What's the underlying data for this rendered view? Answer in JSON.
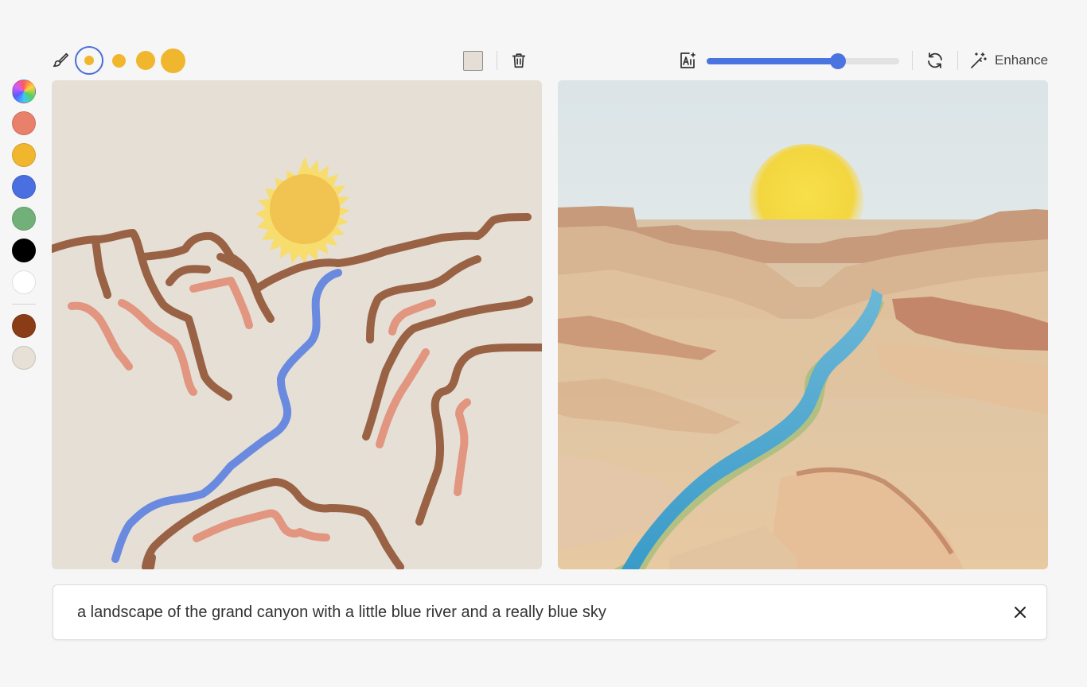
{
  "toolbar": {
    "brush_icon": "brush-icon",
    "brush_sizes": [
      {
        "name": "brush-size-xs",
        "selected": true
      },
      {
        "name": "brush-size-s",
        "selected": false
      },
      {
        "name": "brush-size-m",
        "selected": false
      },
      {
        "name": "brush-size-l",
        "selected": false
      }
    ],
    "brush_color": "#f0b72e",
    "background_color": "#e4ded5",
    "trash_icon": "trash-icon",
    "ai_icon": "ai-image-icon",
    "strength_slider": {
      "value": 0.68,
      "color": "#4a74e0"
    },
    "regenerate_icon": "refresh-icon",
    "enhance_label": "Enhance",
    "enhance_icon": "magic-wand-icon"
  },
  "palette": {
    "colors": [
      "rainbow",
      "#e8806a",
      "#f0b72e",
      "#4a6fe0",
      "#72b07a",
      "#000000",
      "#ffffff"
    ],
    "recent_colors": [
      "#8a3c17",
      "#e6e0d7"
    ]
  },
  "prompt": {
    "text": "a landscape of the grand canyon with a little blue river and a really blue sky",
    "clear_icon": "close-icon"
  }
}
